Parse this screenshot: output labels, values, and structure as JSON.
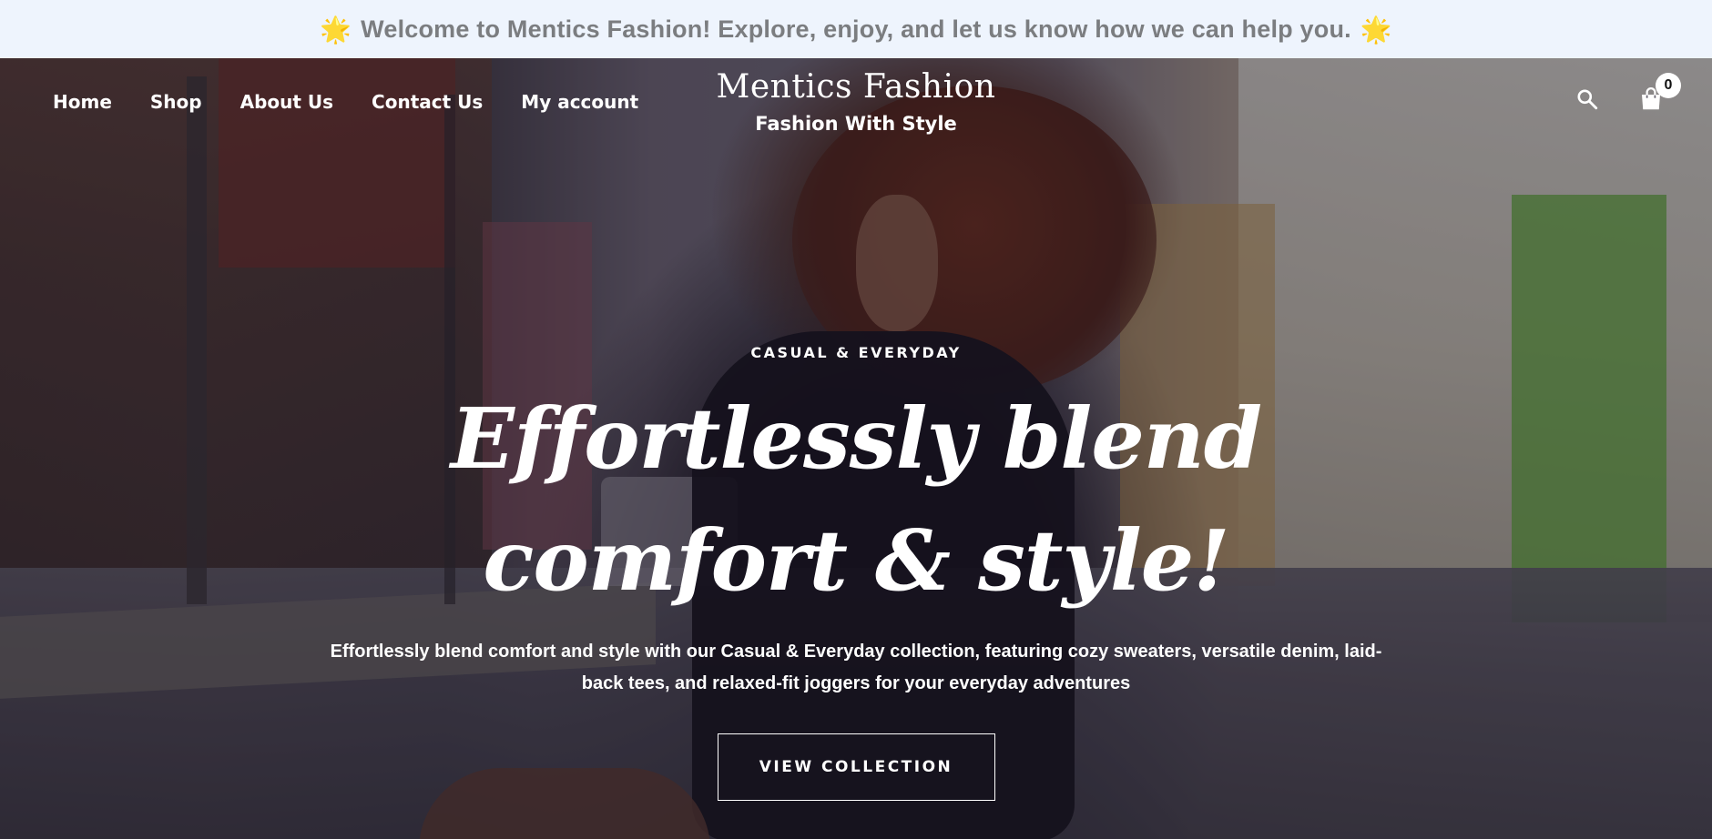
{
  "announcement": {
    "icon_left": "sun-emoji",
    "text": "Welcome to Mentics Fashion! Explore, enjoy, and let us know how we can help you.",
    "icon_right": "sun-emoji",
    "sun_glyph": "🌟"
  },
  "nav": {
    "items": [
      {
        "label": "Home"
      },
      {
        "label": "Shop"
      },
      {
        "label": "About Us"
      },
      {
        "label": "Contact Us"
      },
      {
        "label": "My account"
      }
    ]
  },
  "brand": {
    "title": "Mentics Fashion",
    "tagline": "Fashion With Style"
  },
  "header_icons": {
    "search_icon": "search-icon",
    "cart_icon": "shopping-bag-icon",
    "cart_count": "0"
  },
  "hero": {
    "eyebrow": "CASUAL & EVERYDAY",
    "headline": "Effortlessly blend comfort & style!",
    "description": "Effortlessly blend comfort and style with our Casual & Everyday collection, featuring cozy sweaters, versatile denim, laid-back tees, and relaxed-fit joggers for your everyday adventures",
    "cta_label": "VIEW COLLECTION"
  },
  "colors": {
    "announcement_bg": "#eef4fd",
    "announcement_text": "#7b7d80",
    "hero_text": "#ffffff"
  }
}
